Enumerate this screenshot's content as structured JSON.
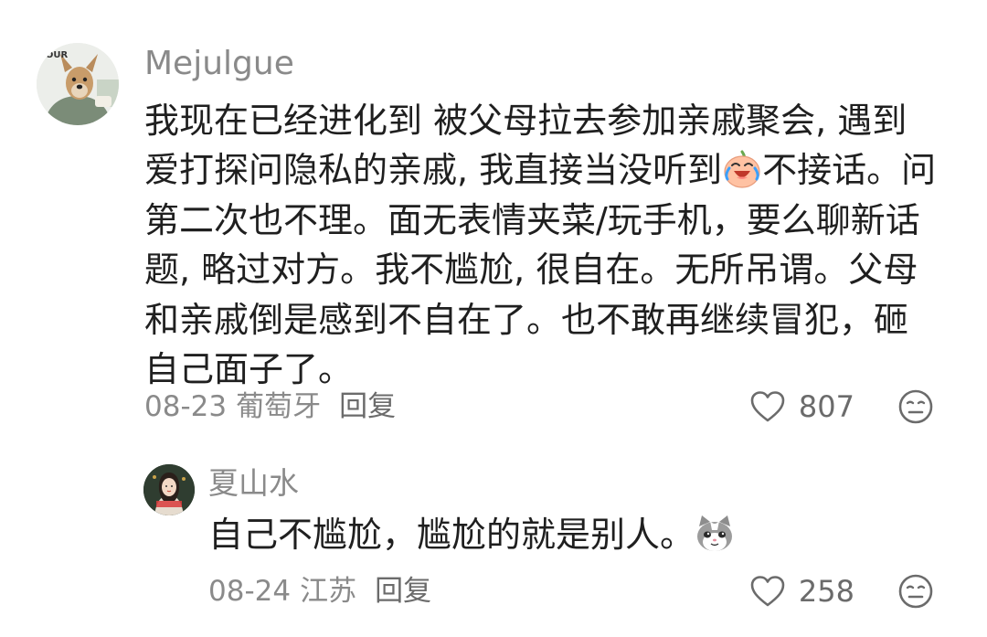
{
  "comments": [
    {
      "username": "Mejulgue",
      "avatar_text": "YOUR",
      "text_lines": [
        "我现在已经进化到 被父母拉去参加亲戚聚会, 遇到",
        "爱打探问隐私的亲戚, 我直接当没听到",
        "第二次也不理。面无表情夹菜/玩手机，要么聊新话",
        "题, 略过对方。我不尴尬, 很自在。无所吊谓。父母",
        "和亲戚倒是感到不自在了。也不敢再继续冒犯，砸",
        "自己面子了。"
      ],
      "line2_after_emoji": "不接话。问",
      "inline_emoji": "laughing-crying-face",
      "date": "08-23",
      "location": "葡萄牙",
      "reply_label": "回复",
      "like_count": "807"
    },
    {
      "username": "夏山水",
      "text": "自己不尴尬，尴尬的就是别人。",
      "trailing_emoji": "cat-face",
      "date": "08-24",
      "location": "江苏",
      "reply_label": "回复",
      "like_count": "258"
    }
  ],
  "colors": {
    "text": "#1f1f1f",
    "secondary": "#8a8a8a",
    "icon": "#6b6b6b"
  }
}
